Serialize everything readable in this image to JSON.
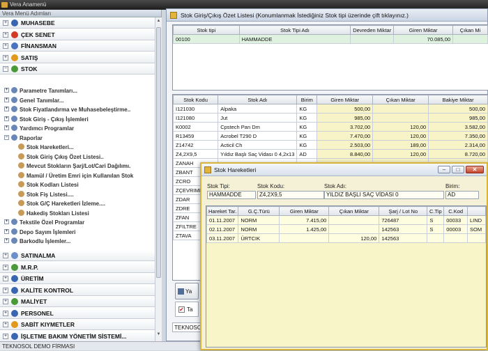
{
  "app": {
    "title": "Vera Anamenü"
  },
  "left": {
    "header": "Vera Menü Adımları",
    "sections_top": [
      {
        "label": "MUHASEBE",
        "pm": "+",
        "color": "#3a66b0"
      },
      {
        "label": "ÇEK SENET",
        "pm": "+",
        "color": "#d23b2a"
      },
      {
        "label": "FİNANSMAN",
        "pm": "+",
        "color": "#4a73bf"
      },
      {
        "label": "SATIŞ",
        "pm": "+",
        "color": "#e29a1c"
      },
      {
        "label": "STOK",
        "pm": "−",
        "color": "#4a9a3a"
      }
    ],
    "tree": [
      {
        "label": "Parametre Tanımları...",
        "indent": 1
      },
      {
        "label": "Genel Tanımlar...",
        "indent": 1
      },
      {
        "label": "Stok Fiyatlandırma ve Muhasebeleştirme..",
        "indent": 1
      },
      {
        "label": "Stok Giriş - Çıkış İşlemleri",
        "indent": 1
      },
      {
        "label": "Yardımcı Programlar",
        "indent": 1
      },
      {
        "label": "Raporlar",
        "indent": 1
      },
      {
        "label": "Stok Hareketleri...",
        "indent": 2
      },
      {
        "label": "Stok Giriş Çıkış Özet Listesi..",
        "indent": 2
      },
      {
        "label": "Mevcut Stokların Şarj/Lot/Cari Dağılımı.",
        "indent": 2
      },
      {
        "label": "Mamül / Üretim Emri için Kullanılan Stok",
        "indent": 2
      },
      {
        "label": "Stok Kodları Listesi",
        "indent": 2
      },
      {
        "label": "Stok Fiş Listesi....",
        "indent": 2
      },
      {
        "label": "Stok G/Ç Hareketleri İzleme....",
        "indent": 2
      },
      {
        "label": "Hakediş Stokları Listesi",
        "indent": 2
      },
      {
        "label": "Tekstile Özel Programlar",
        "indent": 1
      },
      {
        "label": "Depo Sayım İşlemleri",
        "indent": 1
      },
      {
        "label": "Barkodlu İşlemler...",
        "indent": 1
      }
    ],
    "sections_bottom": [
      {
        "label": "SATINALMA",
        "pm": "+",
        "color": "#6d8fc9"
      },
      {
        "label": "M.R.P.",
        "pm": "+",
        "color": "#4a9a3a"
      },
      {
        "label": "ÜRETİM",
        "pm": "+",
        "color": "#3a66b0"
      },
      {
        "label": "KALİTE KONTROL",
        "pm": "+",
        "color": "#3a66b0"
      },
      {
        "label": "MALİYET",
        "pm": "+",
        "color": "#4a9a3a"
      },
      {
        "label": "PERSONEL",
        "pm": "+",
        "color": "#3a66b0"
      },
      {
        "label": "SABİT KIYMETLER",
        "pm": "+",
        "color": "#e29a1c"
      },
      {
        "label": "İŞLETME BAKIM YÖNETİM SİSTEMİ...",
        "pm": "+",
        "color": "#3a66b0"
      }
    ]
  },
  "status": "TEKNOSOL DEMO FİRMASI",
  "main": {
    "title": "Stok Giriş/Çıkış Özet Listesi (Konumlanmak İstediğiniz Stok tipi üzerinde çift tıklayınız.)",
    "top_grid": {
      "headers": [
        "Stok tipi",
        "Stok Tipi Adı",
        "Devreden Miktar",
        "Giren Miktar",
        "Çıkan Mi"
      ],
      "rows": [
        [
          "00100",
          "HAMMADDE",
          "",
          "70.085,00",
          ""
        ]
      ]
    },
    "bottom_grid": {
      "headers": [
        "Stok Kodu",
        "Stok Adı",
        "Birim",
        "Giren Miktar",
        "Çıkan Miktar",
        "Bakiye Miktar"
      ],
      "rows": [
        [
          "I121030",
          "Alpaka",
          "KG",
          "500,00",
          "",
          "500,00"
        ],
        [
          "I121080",
          "Jut",
          "KG",
          "985,00",
          "",
          "985,00"
        ],
        [
          "K0002",
          "Cpstech Pan Dm",
          "KG",
          "3.702,00",
          "120,00",
          "3.582,00"
        ],
        [
          "R13459",
          "Acrobel T290 D",
          "KG",
          "7.470,00",
          "120,00",
          "7.350,00"
        ],
        [
          "Z14742",
          "Acticil Ch",
          "KG",
          "2.503,00",
          "189,00",
          "2.314,00"
        ],
        [
          "Z4,2X9,5",
          "Yıldız Başlı Saç Vidası 0 4,2x13",
          "AD",
          "8.840,00",
          "120,00",
          "8.720,00"
        ],
        [
          "ZANAH",
          "",
          "",
          "",
          "",
          ""
        ],
        [
          "ZBANT",
          "",
          "",
          "",
          "",
          ""
        ],
        [
          "ZCRO",
          "",
          "",
          "",
          "",
          ""
        ],
        [
          "ZÇEVRIME",
          "",
          "",
          "",
          "",
          ""
        ],
        [
          "ZDAR",
          "",
          "",
          "",
          "",
          ""
        ],
        [
          "ZDRE",
          "",
          "",
          "",
          "",
          ""
        ],
        [
          "ZFAN",
          "",
          "",
          "",
          "",
          ""
        ],
        [
          "ZFILTRE",
          "",
          "",
          "",
          "",
          ""
        ],
        [
          "ZTAVA",
          "",
          "",
          "",
          "",
          ""
        ]
      ]
    },
    "button_label": "Ya",
    "checkbox_label": "Ta",
    "footer": "TEKNOSOL D"
  },
  "overlay": {
    "title": "Stok Hareketleri",
    "fields": {
      "stok_tipi_label": "Stok Tipi:",
      "stok_tipi_value": "HAMMADDE",
      "stok_kodu_label": "Stok Kodu:",
      "stok_kodu_value": "Z4,2X9,5",
      "stok_adi_label": "Stok Adı:",
      "stok_adi_value": "YILDIZ BAŞLI SAÇ VİDASI 0",
      "birim_label": "Birim:",
      "birim_value": "AD"
    },
    "grid": {
      "headers": [
        "Hareket Tar.",
        "G.Ç.Türü",
        "Giren Miktar",
        "Çıkan Miktar",
        "Şarj / Lot No",
        "C.Tip",
        "C.Kod",
        ""
      ],
      "rows": [
        [
          "01.11.2007",
          "NORM",
          "7.415,00",
          "",
          "726487",
          "S",
          "00033",
          "LIND"
        ],
        [
          "02.11.2007",
          "NORM",
          "1.425,00",
          "",
          "142563",
          "S",
          "00003",
          "SOM"
        ],
        [
          "03.11.2007",
          "ÜRTCIK",
          "",
          "120,00",
          "142563",
          "",
          "",
          ""
        ]
      ]
    }
  }
}
